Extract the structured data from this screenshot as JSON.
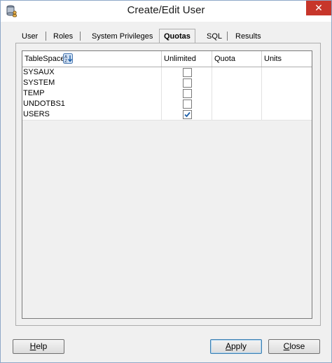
{
  "window": {
    "title": "Create/Edit User",
    "close_glyph": "✕"
  },
  "tabs": [
    {
      "label": "User",
      "active": false
    },
    {
      "label": "Roles",
      "active": false
    },
    {
      "label": "System Privileges",
      "active": false
    },
    {
      "label": "Quotas",
      "active": true
    },
    {
      "label": "SQL",
      "active": false
    },
    {
      "label": "Results",
      "active": false
    }
  ],
  "grid": {
    "columns": [
      "TableSpace",
      "Unlimited",
      "Quota",
      "Units"
    ],
    "rows": [
      {
        "tablespace": "SYSAUX",
        "unlimited": false,
        "quota": "",
        "units": ""
      },
      {
        "tablespace": "SYSTEM",
        "unlimited": false,
        "quota": "",
        "units": ""
      },
      {
        "tablespace": "TEMP",
        "unlimited": false,
        "quota": "",
        "units": ""
      },
      {
        "tablespace": "UNDOTBS1",
        "unlimited": false,
        "quota": "",
        "units": ""
      },
      {
        "tablespace": "USERS",
        "unlimited": true,
        "quota": "",
        "units": ""
      }
    ]
  },
  "buttons": {
    "help": {
      "prefix": "",
      "mnemonic": "H",
      "suffix": "elp"
    },
    "apply": {
      "prefix": "",
      "mnemonic": "A",
      "suffix": "pply"
    },
    "close": {
      "prefix": "",
      "mnemonic": "C",
      "suffix": "lose"
    }
  },
  "icons": {
    "app": "database-user-icon",
    "sort": "sort-ascending-icon",
    "check": "checkmark-icon"
  },
  "colors": {
    "close_button": "#c7362b",
    "checkmark": "#1e5fa8"
  }
}
